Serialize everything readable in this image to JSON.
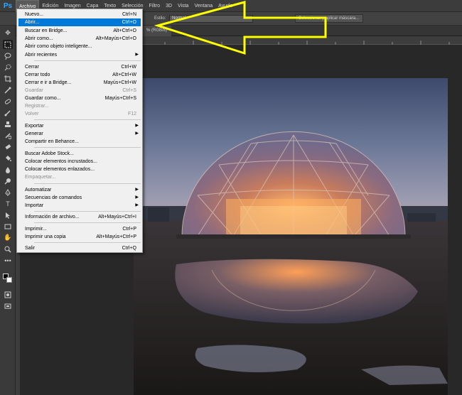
{
  "app": {
    "logo": "Ps"
  },
  "menubar": {
    "items": [
      "Archivo",
      "Edición",
      "Imagen",
      "Capa",
      "Texto",
      "Selección",
      "Filtro",
      "3D",
      "Vista",
      "Ventana",
      "Ayuda"
    ]
  },
  "options": {
    "style_label": "Estilo:",
    "style_value": "Normal",
    "mask_button": "Seleccionar y aplicar máscara..."
  },
  "document": {
    "tab_label": "% (RGB/8)"
  },
  "file_menu": {
    "items": [
      {
        "label": "Nuevo...",
        "shortcut": "Ctrl+N"
      },
      {
        "label": "Abrir...",
        "shortcut": "Ctrl+O"
      },
      {
        "label": "Buscar en Bridge...",
        "shortcut": "Alt+Ctrl+O"
      },
      {
        "label": "Abrir como...",
        "shortcut": "Alt+Mayús+Ctrl+O"
      },
      {
        "label": "Abrir como objeto inteligente...",
        "shortcut": ""
      },
      {
        "label": "Abrir recientes",
        "shortcut": ""
      },
      {
        "label": "Cerrar",
        "shortcut": "Ctrl+W"
      },
      {
        "label": "Cerrar todo",
        "shortcut": "Alt+Ctrl+W"
      },
      {
        "label": "Cerrar e ir a Bridge...",
        "shortcut": "Mayús+Ctrl+W"
      },
      {
        "label": "Guardar",
        "shortcut": "Ctrl+S"
      },
      {
        "label": "Guardar como...",
        "shortcut": "Mayús+Ctrl+S"
      },
      {
        "label": "Registrar...",
        "shortcut": ""
      },
      {
        "label": "Volver",
        "shortcut": "F12"
      },
      {
        "label": "Exportar",
        "shortcut": ""
      },
      {
        "label": "Generar",
        "shortcut": ""
      },
      {
        "label": "Compartir en Behance...",
        "shortcut": ""
      },
      {
        "label": "Buscar Adobe Stock...",
        "shortcut": ""
      },
      {
        "label": "Colocar elementos incrustados...",
        "shortcut": ""
      },
      {
        "label": "Colocar elementos enlazados...",
        "shortcut": ""
      },
      {
        "label": "Empaquetar...",
        "shortcut": ""
      },
      {
        "label": "Automatizar",
        "shortcut": ""
      },
      {
        "label": "Secuencias de comandos",
        "shortcut": ""
      },
      {
        "label": "Importar",
        "shortcut": ""
      },
      {
        "label": "Información de archivo...",
        "shortcut": "Alt+Mayús+Ctrl+I"
      },
      {
        "label": "Imprimir...",
        "shortcut": "Ctrl+P"
      },
      {
        "label": "Imprimir una copia",
        "shortcut": "Alt+Mayús+Ctrl+P"
      },
      {
        "label": "Salir",
        "shortcut": "Ctrl+Q"
      }
    ]
  },
  "colors": {
    "highlight": "#0078d7",
    "annotation_arrow": "#ffff00",
    "ps_blue": "#31a8ff"
  }
}
